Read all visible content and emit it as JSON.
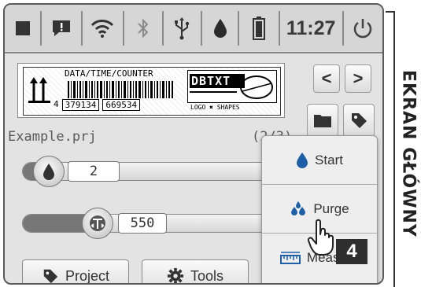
{
  "status_bar": {
    "time": "11:27",
    "icons": [
      "stop-icon",
      "message-icon",
      "wifi-icon",
      "bluetooth-icon",
      "usb-icon",
      "ink-drop-icon",
      "battery-icon",
      "power-icon"
    ]
  },
  "preview": {
    "header_text": "DATA/TIME/COUNTER",
    "barcode_numbers": [
      "4",
      "379134",
      "669534"
    ],
    "logo_text": "DBTXT",
    "shapes_caption": "LOGO ✖ SHAPES"
  },
  "project": {
    "file_name": "Example.prj",
    "counter": "(2/3)"
  },
  "nav": {
    "prev": "<",
    "next": ">"
  },
  "sliders": {
    "ink": {
      "value": "2"
    },
    "pressure": {
      "value": "550"
    }
  },
  "bottom_buttons": {
    "project": "Project",
    "tools": "Tools"
  },
  "popup_menu": {
    "items": [
      {
        "label": "Start",
        "icon": "ink-drop-icon"
      },
      {
        "label": "Purge",
        "icon": "droplets-icon"
      },
      {
        "label": "Measure",
        "icon": "ruler-icon"
      }
    ]
  },
  "callout": {
    "number": "4"
  },
  "side_label": "EKRAN GŁÓWNY",
  "colors": {
    "device_bg": "#e3e3e3",
    "accent_blue": "#1e5fa8",
    "dark": "#333333"
  }
}
